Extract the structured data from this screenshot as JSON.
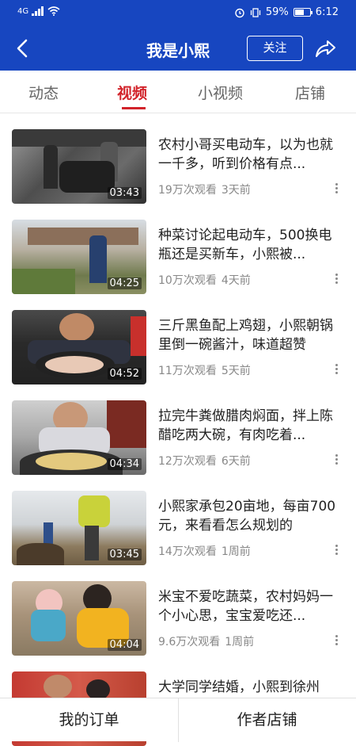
{
  "status": {
    "network": "4G",
    "battery": "59%",
    "time": "6:12"
  },
  "header": {
    "title": "我是小熙",
    "follow_label": "关注"
  },
  "tabs": [
    {
      "label": "动态"
    },
    {
      "label": "视频"
    },
    {
      "label": "小视频"
    },
    {
      "label": "店铺"
    }
  ],
  "active_tab": "视频",
  "videos": [
    {
      "title": "农村小哥买电动车，以为也就一千多，听到价格有点...",
      "duration": "03:43",
      "views": "19万次观看",
      "age": "3天前"
    },
    {
      "title": "种菜讨论起电动车，500换电瓶还是买新车，小熙被...",
      "duration": "04:25",
      "views": "10万次观看",
      "age": "4天前"
    },
    {
      "title": "三斤黑鱼配上鸡翅，小熙朝锅里倒一碗酱汁，味道超赞",
      "duration": "04:52",
      "views": "11万次观看",
      "age": "5天前"
    },
    {
      "title": "拉完牛粪做腊肉焖面，拌上陈醋吃两大碗，有肉吃着...",
      "duration": "04:34",
      "views": "12万次观看",
      "age": "6天前"
    },
    {
      "title": "小熙家承包20亩地，每亩700元，来看看怎么规划的",
      "duration": "03:45",
      "views": "14万次观看",
      "age": "1周前"
    },
    {
      "title": "米宝不爱吃蔬菜，农村妈妈一个小心思，宝宝爱吃还...",
      "duration": "04:04",
      "views": "9.6万次观看",
      "age": "1周前"
    },
    {
      "title": "大学同学结婚，小熙到徐州",
      "duration": "",
      "views": "",
      "age": ""
    }
  ],
  "bottom": {
    "orders_label": "我的订单",
    "shop_label": "作者店铺"
  }
}
